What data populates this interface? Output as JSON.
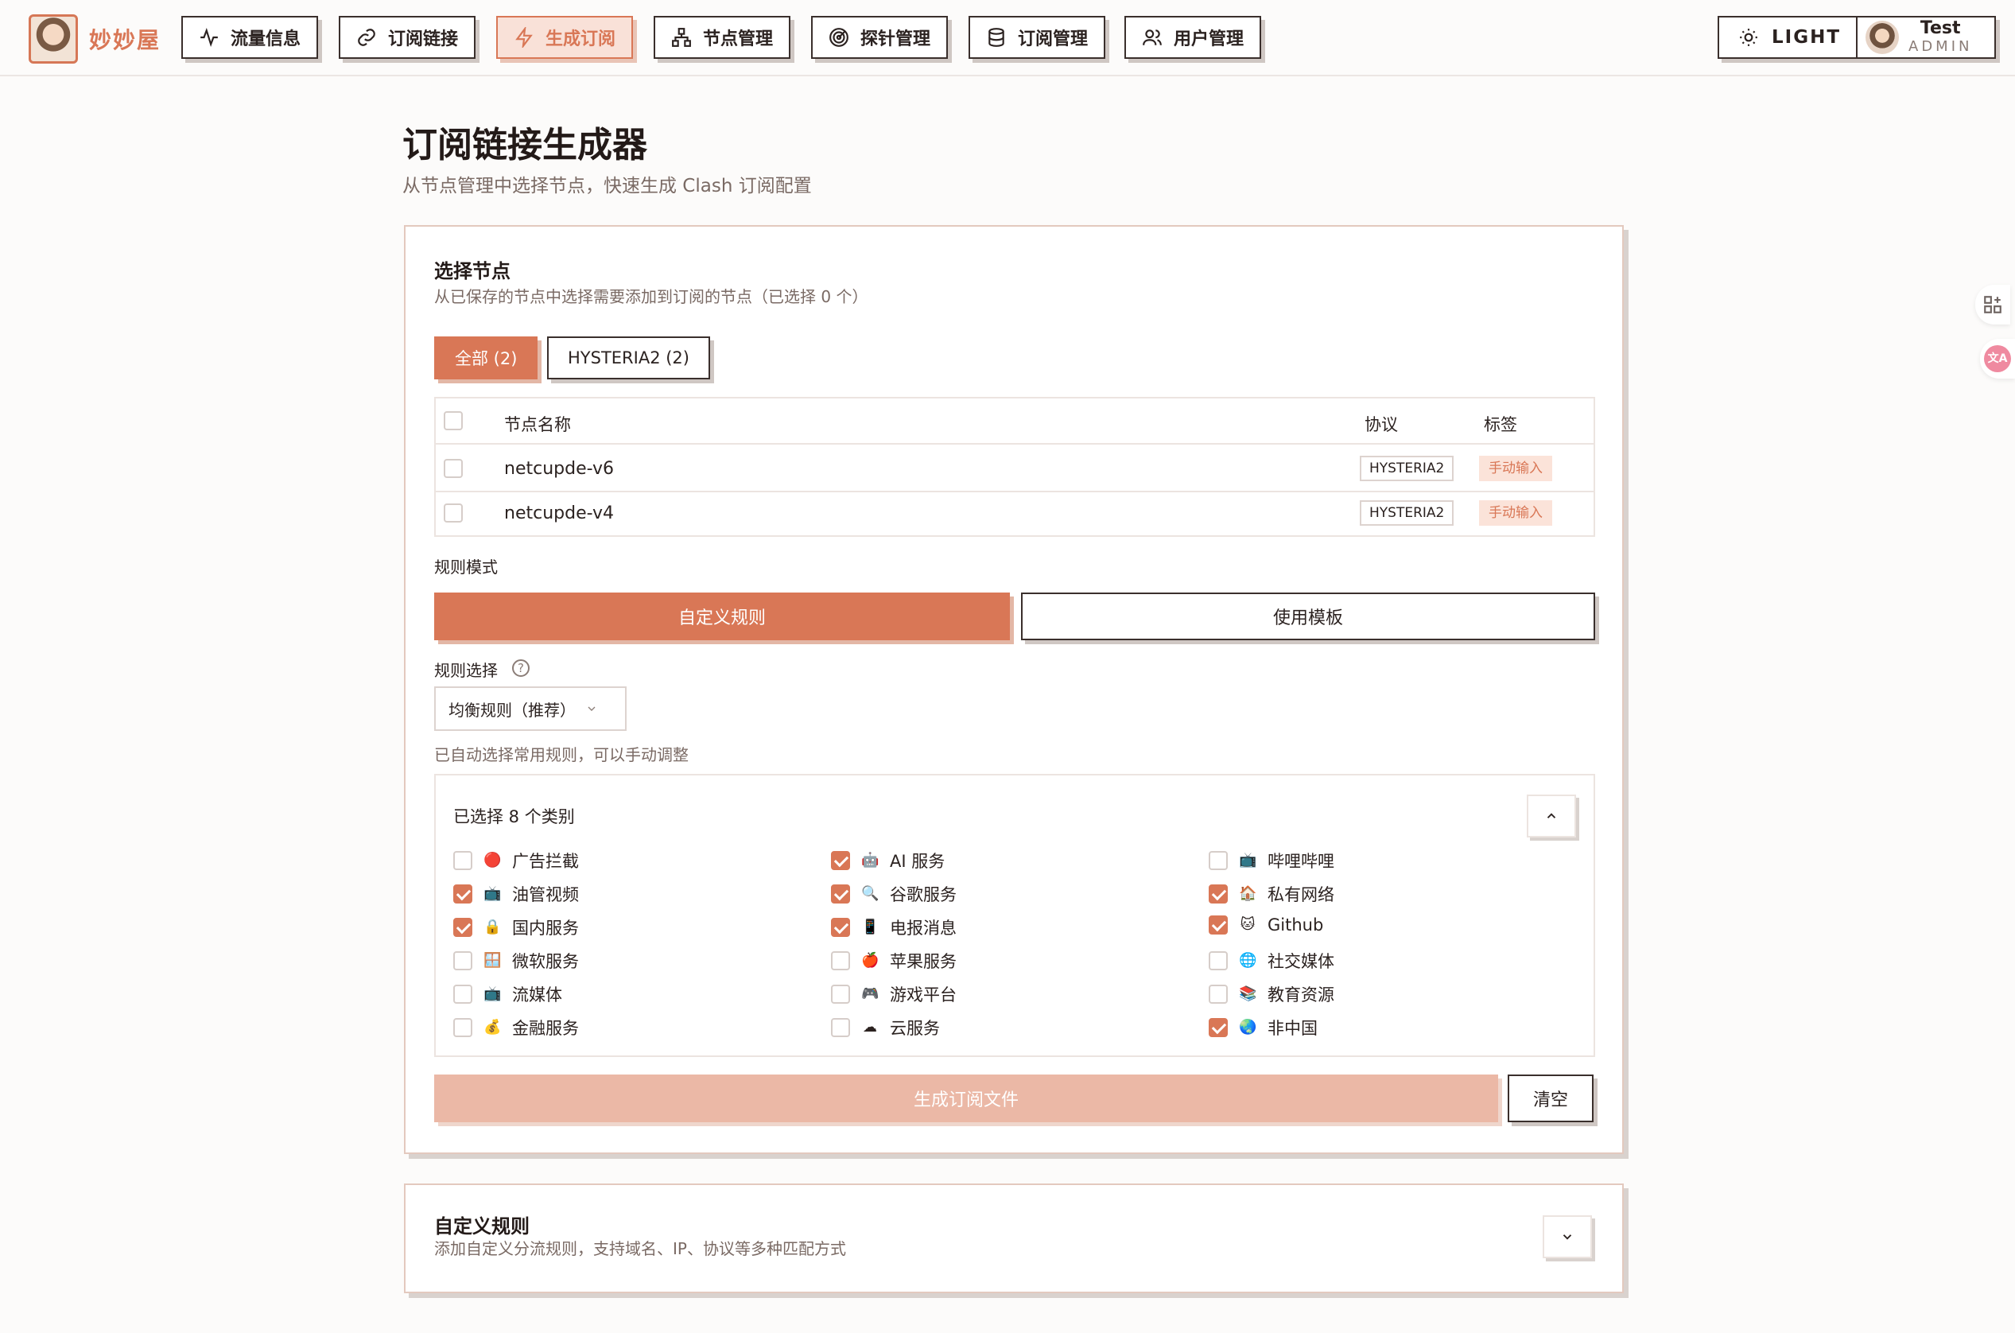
{
  "app": {
    "logo_text": "妙妙屋"
  },
  "nav": [
    {
      "label": "流量信息",
      "icon": "activity-icon"
    },
    {
      "label": "订阅链接",
      "icon": "link-icon"
    },
    {
      "label": "生成订阅",
      "icon": "lightning-icon"
    },
    {
      "label": "节点管理",
      "icon": "network-icon"
    },
    {
      "label": "探针管理",
      "icon": "radar-icon"
    },
    {
      "label": "订阅管理",
      "icon": "database-icon"
    },
    {
      "label": "用户管理",
      "icon": "users-icon"
    }
  ],
  "theme_toggle": {
    "label": "LIGHT"
  },
  "user": {
    "name": "Test",
    "role": "ADMIN"
  },
  "page": {
    "title": "订阅链接生成器",
    "subtitle": "从节点管理中选择节点，快速生成 Clash 订阅配置"
  },
  "nodes_section": {
    "title": "选择节点",
    "desc": "从已保存的节点中选择需要添加到订阅的节点（已选择 0 个）",
    "filters": [
      "全部 (2)",
      "HYSTERIA2 (2)"
    ],
    "table": {
      "headers": {
        "name": "节点名称",
        "protocol": "协议",
        "tag": "标签"
      },
      "rows": [
        {
          "name": "netcupde-v6",
          "protocol": "HYSTERIA2",
          "tag": "手动输入"
        },
        {
          "name": "netcupde-v4",
          "protocol": "HYSTERIA2",
          "tag": "手动输入"
        }
      ]
    }
  },
  "rule_mode": {
    "label": "规则模式",
    "options": [
      "自定义规则",
      "使用模板"
    ]
  },
  "rule_select": {
    "label": "规则选择",
    "value": "均衡规则（推荐）",
    "hint": "已自动选择常用规则，可以手动调整"
  },
  "categories": {
    "summary": "已选择 8 个类别",
    "items": [
      {
        "label": "广告拦截",
        "checked": false,
        "icon": "🔴"
      },
      {
        "label": "AI 服务",
        "checked": true,
        "icon": "🤖"
      },
      {
        "label": "哔哩哔哩",
        "checked": false,
        "icon": "📺"
      },
      {
        "label": "油管视频",
        "checked": true,
        "icon": "📺"
      },
      {
        "label": "谷歌服务",
        "checked": true,
        "icon": "🔍"
      },
      {
        "label": "私有网络",
        "checked": true,
        "icon": "🏠"
      },
      {
        "label": "国内服务",
        "checked": true,
        "icon": "🔒"
      },
      {
        "label": "电报消息",
        "checked": true,
        "icon": "📱"
      },
      {
        "label": "Github",
        "checked": true,
        "icon": "🐱"
      },
      {
        "label": "微软服务",
        "checked": false,
        "icon": "🪟"
      },
      {
        "label": "苹果服务",
        "checked": false,
        "icon": "🍎"
      },
      {
        "label": "社交媒体",
        "checked": false,
        "icon": "🌐"
      },
      {
        "label": "流媒体",
        "checked": false,
        "icon": "📺"
      },
      {
        "label": "游戏平台",
        "checked": false,
        "icon": "🎮"
      },
      {
        "label": "教育资源",
        "checked": false,
        "icon": "📚"
      },
      {
        "label": "金融服务",
        "checked": false,
        "icon": "💰"
      },
      {
        "label": "云服务",
        "checked": false,
        "icon": "☁"
      },
      {
        "label": "非中国",
        "checked": true,
        "icon": "🌏"
      }
    ]
  },
  "actions": {
    "generate": "生成订阅文件",
    "clear": "清空"
  },
  "custom_rules": {
    "title": "自定义规则",
    "desc": "添加自定义分流规则，支持域名、IP、协议等多种匹配方式"
  },
  "colors": {
    "accent": "#d97756",
    "accent_light": "#ebb8a6",
    "border": "#3a2f2c"
  }
}
